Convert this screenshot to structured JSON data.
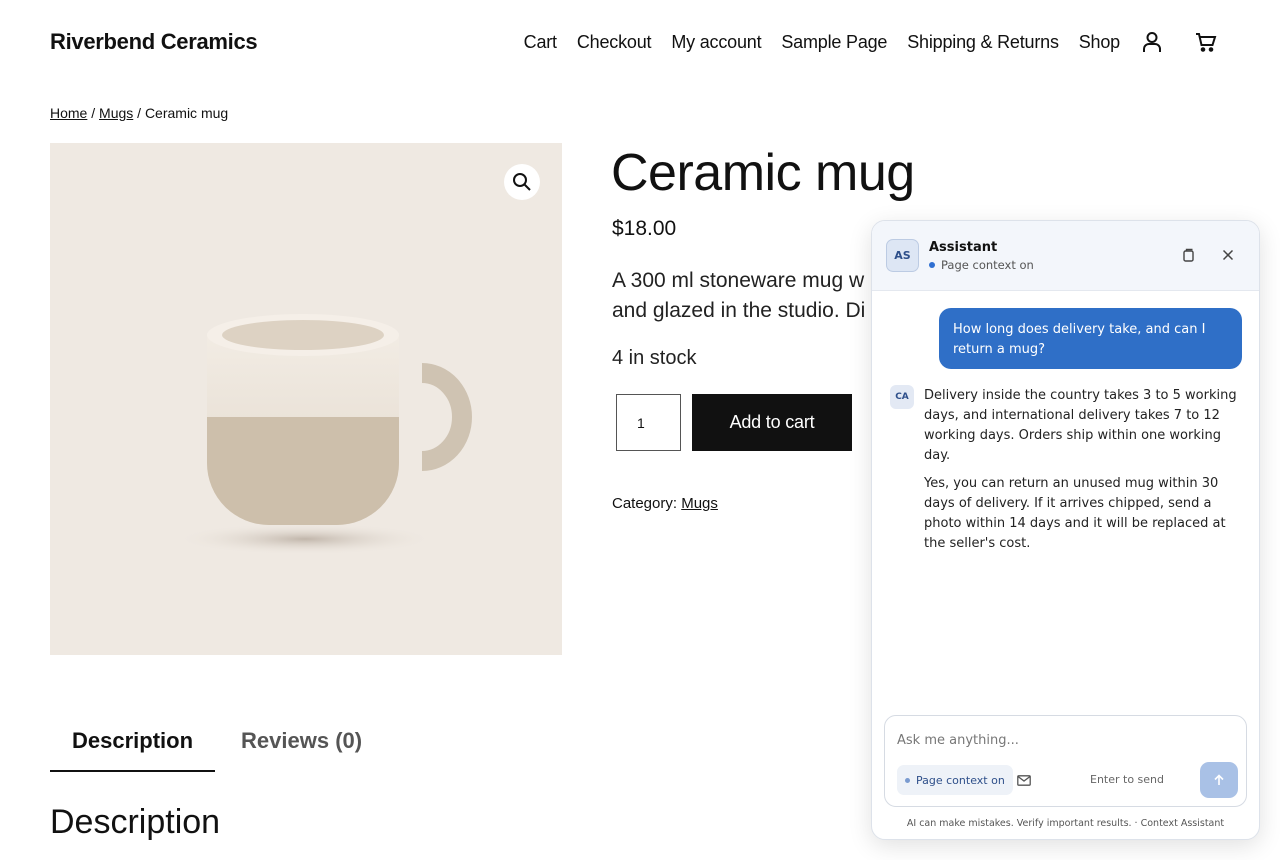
{
  "site": {
    "brand": "Riverbend Ceramics",
    "nav": [
      "Cart",
      "Checkout",
      "My account",
      "Sample Page",
      "Shipping & Returns",
      "Shop"
    ]
  },
  "breadcrumb": {
    "home": "Home",
    "sep1": " / ",
    "category": "Mugs",
    "sep2": " / ",
    "current": "Ceramic mug"
  },
  "product": {
    "title": "Ceramic mug",
    "price": "$18.00",
    "short_description": "A 300 ml stoneware mug w",
    "short_description_line2": "and glazed in the studio. Di",
    "stock": "4 in stock",
    "quantity": "1",
    "add_to_cart": "Add to cart",
    "category_label": "Category:",
    "category_value": "Mugs"
  },
  "tabs": {
    "items": [
      "Description",
      "Reviews (0)"
    ],
    "active": "Description",
    "section_heading": "Description"
  },
  "chat": {
    "avatar": "AS",
    "title": "Assistant",
    "status": "Page context on",
    "user_message": "How long does delivery take, and can I return a mug?",
    "bot_avatar": "CA",
    "bot_paragraphs": [
      "Delivery inside the country takes 3 to 5 working days, and international delivery takes 7 to 12 working days. Orders ship within one working day.",
      "Yes, you can return an unused mug within 30 days of delivery. If it arrives chipped, send a photo within 14 days and it will be replaced at the seller's cost."
    ],
    "input_placeholder": "Ask me anything...",
    "context_chip": "Page context on",
    "enter_hint": "Enter to send",
    "footer": "AI can make mistakes. Verify important results.  ·  Context Assistant"
  },
  "icons": {
    "account": "user-icon",
    "cart": "cart-icon",
    "zoom": "magnifier-icon",
    "copy": "copy-icon",
    "close": "close-icon",
    "mail": "mail-icon",
    "send": "arrow-up-icon"
  },
  "colors": {
    "accent": "#2f6fc7",
    "image_bg": "#efe9e2",
    "button_dark": "#111111",
    "send_disabled": "#a9c1e6"
  }
}
